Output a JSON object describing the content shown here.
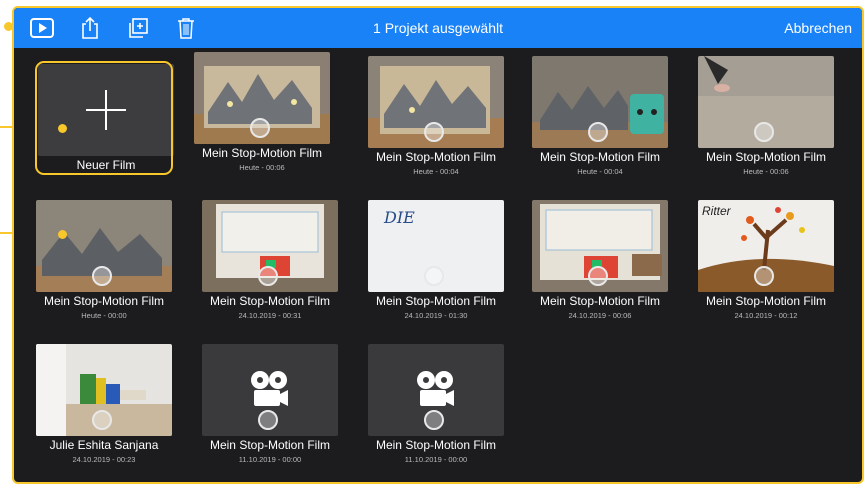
{
  "toolbar": {
    "title": "1 Projekt ausgewählt",
    "cancel_label": "Abbrechen",
    "icons": [
      "play-icon",
      "share-icon",
      "duplicate-icon",
      "trash-icon"
    ]
  },
  "new_movie": {
    "label": "Neuer Film"
  },
  "projects": [
    {
      "title": "Mein Stop-Motion Film",
      "meta": "Heute - 00:06"
    },
    {
      "title": "Mein Stop-Motion Film",
      "meta": "Heute - 00:04"
    },
    {
      "title": "Mein Stop-Motion Film",
      "meta": "Heute - 00:04"
    },
    {
      "title": "Mein Stop-Motion Film",
      "meta": "Heute - 00:06"
    },
    {
      "title": "Mein Stop-Motion Film",
      "meta": "Heute - 00:00"
    },
    {
      "title": "Mein Stop-Motion Film",
      "meta": "24.10.2019 - 00:31"
    },
    {
      "title": "Mein Stop-Motion Film",
      "meta": "24.10.2019 - 01:30"
    },
    {
      "title": "Mein Stop-Motion Film",
      "meta": "24.10.2019 - 00:06"
    },
    {
      "title": "Mein Stop-Motion Film",
      "meta": "24.10.2019 - 00:12"
    },
    {
      "title": "Julie Eshita Sanjana",
      "meta": "24.10.2019 - 00:23"
    },
    {
      "title": "Mein Stop-Motion Film",
      "meta": "11.10.2019 - 00:00"
    },
    {
      "title": "Mein Stop-Motion Film",
      "meta": "11.10.2019 - 00:00"
    }
  ],
  "thumb_texts": {
    "die": "DIE",
    "ritter": "Ritter"
  },
  "colors": {
    "accent": "#1a82f7",
    "highlight": "#f7c72c",
    "background": "#1c1c1e"
  }
}
